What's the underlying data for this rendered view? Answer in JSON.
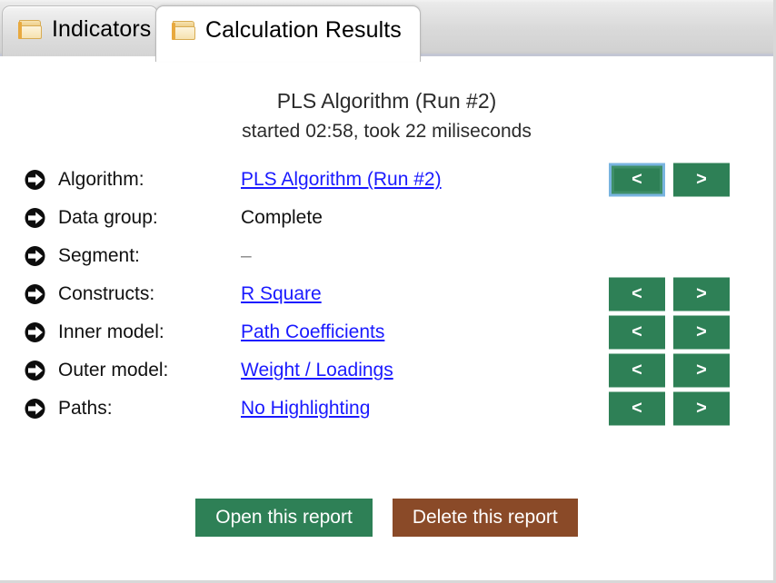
{
  "window": {
    "tabs": [
      {
        "id": "indicators",
        "label": "Indicators",
        "icon": "folder-icon",
        "active": false
      },
      {
        "id": "calculation-results",
        "label": "Calculation Results",
        "icon": "folder-icon",
        "active": true
      }
    ]
  },
  "report": {
    "title": "PLS Algorithm (Run #2)",
    "subtitle": "started 02:58, took 22 miliseconds"
  },
  "details": {
    "rows": [
      {
        "label": "Algorithm:",
        "value": "PLS Algorithm (Run #2)",
        "is_link": true,
        "has_nav": true,
        "nav_focused": true
      },
      {
        "label": "Data group:",
        "value": "Complete",
        "is_link": false,
        "has_nav": false,
        "nav_focused": false
      },
      {
        "label": "Segment:",
        "value": "–",
        "is_link": false,
        "has_nav": false,
        "nav_focused": false
      },
      {
        "label": "Constructs:",
        "value": "R Square",
        "is_link": true,
        "has_nav": true,
        "nav_focused": false
      },
      {
        "label": "Inner model:",
        "value": "Path Coefficients",
        "is_link": true,
        "has_nav": true,
        "nav_focused": false
      },
      {
        "label": "Outer model:",
        "value": "Weight / Loadings",
        "is_link": true,
        "has_nav": true,
        "nav_focused": false
      },
      {
        "label": "Paths:",
        "value": "No Highlighting",
        "is_link": true,
        "has_nav": true,
        "nav_focused": false
      }
    ],
    "nav_prev_label": "<",
    "nav_next_label": ">"
  },
  "actions": {
    "open_label": "Open this report",
    "delete_label": "Delete this report"
  },
  "colors": {
    "green": "#2e8056",
    "brown": "#8a4a28",
    "link": "#1a1aff",
    "focus_ring": "#79b4e0",
    "tabstrip_border": "#c3c6d4"
  }
}
